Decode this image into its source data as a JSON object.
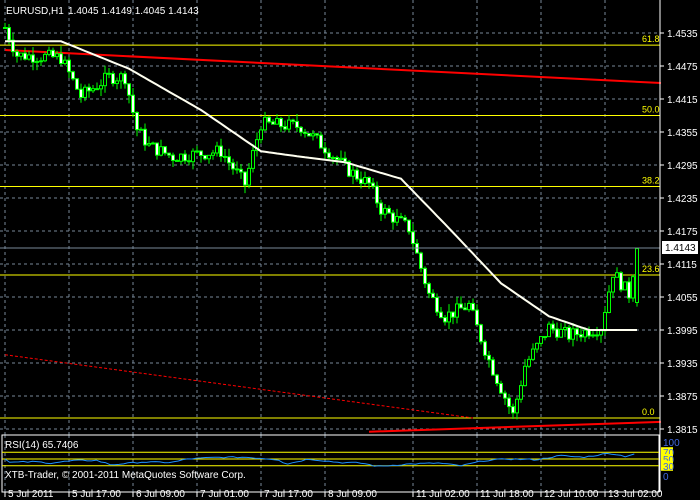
{
  "header": {
    "symbol": "EURUSD,H1",
    "ohlc": "1.4045 1.4149 1.4045 1.4143"
  },
  "current_price": "1.4143",
  "rsi": {
    "label": "RSI(14) 65.7406",
    "scale": [
      "100",
      "70",
      "50",
      "30",
      "0"
    ]
  },
  "copyright": "XTB-Trader, © 2001-2011 MetaQuotes Software Corp.",
  "colors": {
    "bg": "#000000",
    "candle": "#00ff00",
    "ma": "#fffff0",
    "fib": "#ffff00",
    "trend": "#ff0000",
    "rsi": "#1e90ff",
    "grid": "#778899"
  },
  "chart_data": {
    "type": "line",
    "title": "EURUSD,H1",
    "price_ticks": [
      "1.4535",
      "1.4475",
      "1.4415",
      "1.4355",
      "1.4295",
      "1.4235",
      "1.4175",
      "1.4115",
      "1.4055",
      "1.3995",
      "1.3935",
      "1.3875",
      "1.3815"
    ],
    "time_ticks": [
      "5 Jul 2011",
      "5 Jul 17:00",
      "6 Jul 09:00",
      "7 Jul 01:00",
      "7 Jul 17:00",
      "8 Jul 09:00",
      "11 Jul 02:00",
      "11 Jul 18:00",
      "12 Jul 10:00",
      "13 Jul 02:00"
    ],
    "bars": 159,
    "close_keypoints": [
      [
        0,
        1.4545
      ],
      [
        3,
        1.4495
      ],
      [
        14,
        1.449
      ],
      [
        19,
        1.442
      ],
      [
        26,
        1.4455
      ],
      [
        30,
        1.4455
      ],
      [
        33,
        1.436
      ],
      [
        36,
        1.433
      ],
      [
        42,
        1.431
      ],
      [
        54,
        1.432
      ],
      [
        60,
        1.426
      ],
      [
        64,
        1.437
      ],
      [
        74,
        1.4365
      ],
      [
        81,
        1.432
      ],
      [
        85,
        1.429
      ],
      [
        91,
        1.426
      ],
      [
        94,
        1.4215
      ],
      [
        101,
        1.418
      ],
      [
        106,
        1.406
      ],
      [
        110,
        1.402
      ],
      [
        116,
        1.404
      ],
      [
        121,
        1.394
      ],
      [
        127,
        1.384
      ],
      [
        130,
        1.393
      ],
      [
        136,
        1.4
      ],
      [
        141,
        1.3985
      ],
      [
        149,
        1.4
      ],
      [
        152,
        1.41
      ],
      [
        156,
        1.406
      ],
      [
        158,
        1.4143
      ]
    ],
    "ma_keypoints": [
      [
        0,
        1.452
      ],
      [
        14,
        1.452
      ],
      [
        31,
        1.447
      ],
      [
        49,
        1.4395
      ],
      [
        64,
        1.432
      ],
      [
        74,
        1.431
      ],
      [
        85,
        1.43
      ],
      [
        99,
        1.427
      ],
      [
        111,
        1.418
      ],
      [
        124,
        1.408
      ],
      [
        136,
        1.402
      ],
      [
        146,
        1.3995
      ],
      [
        158,
        1.3995
      ]
    ],
    "fibonacci": [
      {
        "level": "61.8",
        "price": 1.4513
      },
      {
        "level": "50.0",
        "price": 1.4385
      },
      {
        "level": "38.2",
        "price": 1.4256
      },
      {
        "level": "23.6",
        "price": 1.4095
      },
      {
        "level": "0.0",
        "price": 1.3835
      }
    ],
    "trendlines": [
      {
        "from": [
          0,
          1.4504
        ],
        "to": [
          164,
          1.4444
        ],
        "style": "solid"
      },
      {
        "from": [
          0,
          1.395
        ],
        "to": [
          117,
          1.3835
        ],
        "style": "dashed"
      },
      {
        "from": [
          91,
          1.381
        ],
        "to": [
          164,
          1.3828
        ],
        "style": "solid"
      }
    ],
    "rsi_keypoints": [
      [
        0,
        52
      ],
      [
        3,
        40
      ],
      [
        20,
        42
      ],
      [
        30,
        38
      ],
      [
        45,
        45
      ],
      [
        60,
        46
      ],
      [
        70,
        33
      ],
      [
        90,
        41
      ],
      [
        110,
        40
      ],
      [
        120,
        50
      ],
      [
        140,
        55
      ],
      [
        160,
        55
      ],
      [
        180,
        48
      ],
      [
        185,
        35
      ],
      [
        200,
        50
      ],
      [
        220,
        40
      ],
      [
        235,
        38
      ],
      [
        245,
        28
      ],
      [
        265,
        35
      ],
      [
        285,
        38
      ],
      [
        300,
        30
      ],
      [
        315,
        45
      ],
      [
        330,
        50
      ],
      [
        350,
        48
      ],
      [
        365,
        60
      ],
      [
        380,
        55
      ],
      [
        398,
        67
      ],
      [
        408,
        58
      ],
      [
        415,
        66
      ]
    ],
    "rsi_levels": [
      70,
      50,
      30
    ],
    "ylim": [
      1.38,
      1.46
    ]
  }
}
